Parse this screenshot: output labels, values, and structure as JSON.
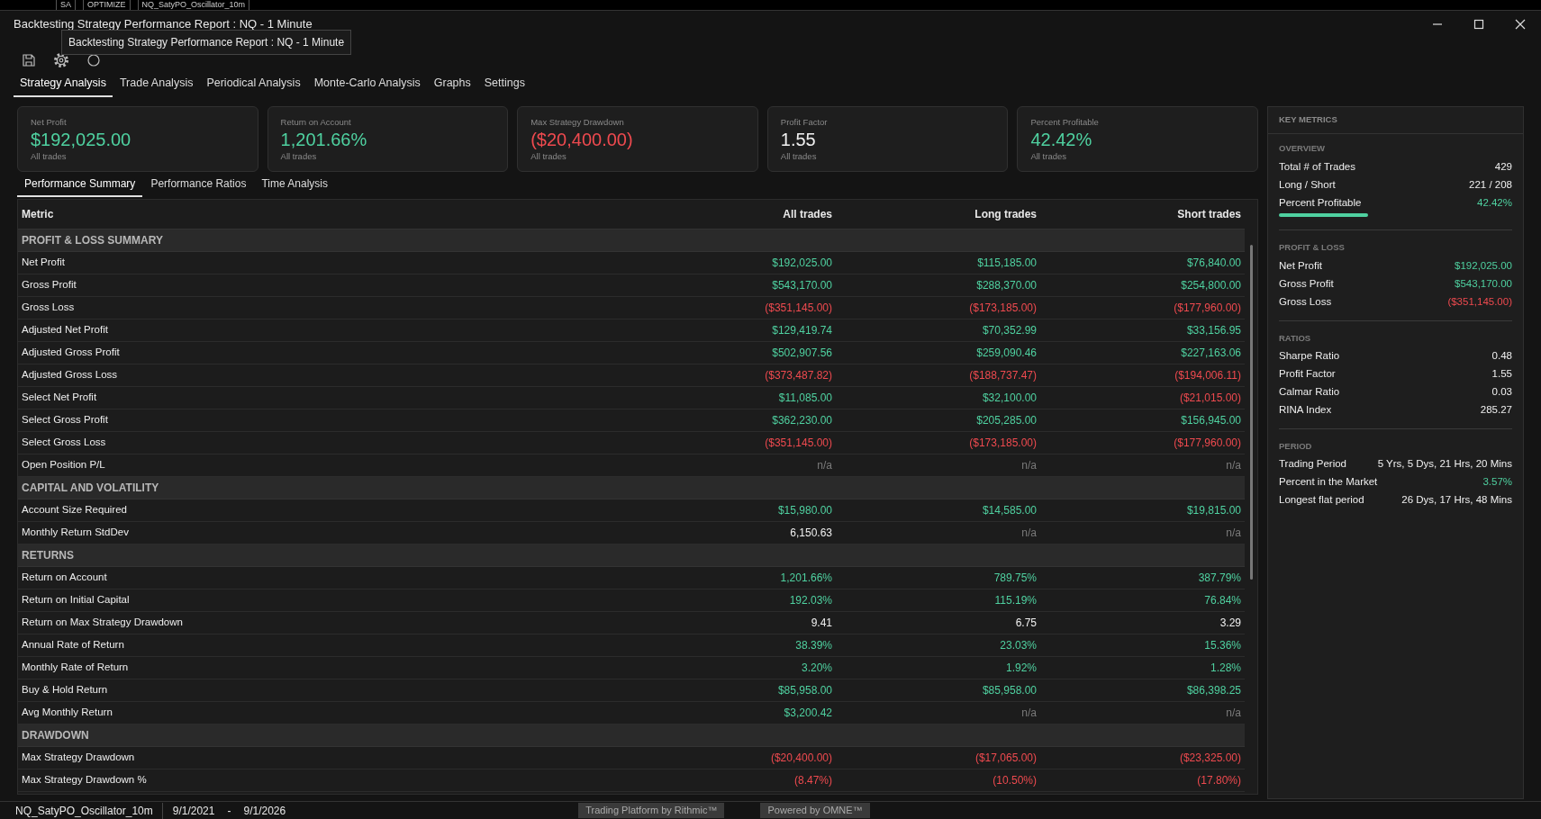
{
  "background_app": {
    "texts": [
      "SA",
      "OPTIMIZE",
      "NQ_SatyPO_Oscillator_10m"
    ]
  },
  "window": {
    "title": "Backtesting Strategy Performance Report : NQ - 1 Minute"
  },
  "tooltip": "Backtesting Strategy Performance Report : NQ - 1 Minute",
  "tabs": [
    {
      "label": "Strategy Analysis",
      "selected": true
    },
    {
      "label": "Trade Analysis",
      "selected": false
    },
    {
      "label": "Periodical Analysis",
      "selected": false
    },
    {
      "label": "Monte-Carlo Analysis",
      "selected": false
    },
    {
      "label": "Graphs",
      "selected": false
    },
    {
      "label": "Settings",
      "selected": false
    }
  ],
  "cards": [
    {
      "label": "Net Profit",
      "value": "$192,025.00",
      "color": "#4fd1a0",
      "note": "All trades"
    },
    {
      "label": "Return on Account",
      "value": "1,201.66%",
      "color": "#4fd1a0",
      "note": "All trades"
    },
    {
      "label": "Max Strategy Drawdown",
      "value": "($20,400.00)",
      "color": "#ef4a4f",
      "note": "All trades"
    },
    {
      "label": "Profit Factor",
      "value": "1.55",
      "color": "#f0f0f0",
      "note": "All trades"
    },
    {
      "label": "Percent Profitable",
      "value": "42.42%",
      "color": "#4fd1a0",
      "note": "All trades"
    }
  ],
  "subtabs": [
    {
      "label": "Performance Summary",
      "selected": true
    },
    {
      "label": "Performance Ratios",
      "selected": false
    },
    {
      "label": "Time Analysis",
      "selected": false
    }
  ],
  "table": {
    "columns": [
      "Metric",
      "All trades",
      "Long trades",
      "Short trades"
    ],
    "rows": [
      {
        "kind": "section",
        "label": "PROFIT & LOSS SUMMARY"
      },
      {
        "kind": "metric",
        "label": "Net Profit",
        "cells": [
          {
            "text": "$192,025.00",
            "color": "#4fd1a0"
          },
          {
            "text": "$115,185.00",
            "color": "#4fd1a0"
          },
          {
            "text": "$76,840.00",
            "color": "#4fd1a0"
          }
        ]
      },
      {
        "kind": "metric",
        "label": "Gross Profit",
        "cells": [
          {
            "text": "$543,170.00",
            "color": "#4fd1a0"
          },
          {
            "text": "$288,370.00",
            "color": "#4fd1a0"
          },
          {
            "text": "$254,800.00",
            "color": "#4fd1a0"
          }
        ]
      },
      {
        "kind": "metric",
        "label": "Gross Loss",
        "cells": [
          {
            "text": "($351,145.00)",
            "color": "#ef4a4f"
          },
          {
            "text": "($173,185.00)",
            "color": "#ef4a4f"
          },
          {
            "text": "($177,960.00)",
            "color": "#ef4a4f"
          }
        ]
      },
      {
        "kind": "metric",
        "label": "Adjusted Net Profit",
        "cells": [
          {
            "text": "$129,419.74",
            "color": "#4fd1a0"
          },
          {
            "text": "$70,352.99",
            "color": "#4fd1a0"
          },
          {
            "text": "$33,156.95",
            "color": "#4fd1a0"
          }
        ]
      },
      {
        "kind": "metric",
        "label": "Adjusted Gross Profit",
        "cells": [
          {
            "text": "$502,907.56",
            "color": "#4fd1a0"
          },
          {
            "text": "$259,090.46",
            "color": "#4fd1a0"
          },
          {
            "text": "$227,163.06",
            "color": "#4fd1a0"
          }
        ]
      },
      {
        "kind": "metric",
        "label": "Adjusted Gross Loss",
        "cells": [
          {
            "text": "($373,487.82)",
            "color": "#ef4a4f"
          },
          {
            "text": "($188,737.47)",
            "color": "#ef4a4f"
          },
          {
            "text": "($194,006.11)",
            "color": "#ef4a4f"
          }
        ]
      },
      {
        "kind": "metric",
        "label": "Select Net Profit",
        "cells": [
          {
            "text": "$11,085.00",
            "color": "#4fd1a0"
          },
          {
            "text": "$32,100.00",
            "color": "#4fd1a0"
          },
          {
            "text": "($21,015.00)",
            "color": "#ef4a4f"
          }
        ]
      },
      {
        "kind": "metric",
        "label": "Select Gross Profit",
        "cells": [
          {
            "text": "$362,230.00",
            "color": "#4fd1a0"
          },
          {
            "text": "$205,285.00",
            "color": "#4fd1a0"
          },
          {
            "text": "$156,945.00",
            "color": "#4fd1a0"
          }
        ]
      },
      {
        "kind": "metric",
        "label": "Select Gross Loss",
        "cells": [
          {
            "text": "($351,145.00)",
            "color": "#ef4a4f"
          },
          {
            "text": "($173,185.00)",
            "color": "#ef4a4f"
          },
          {
            "text": "($177,960.00)",
            "color": "#ef4a4f"
          }
        ]
      },
      {
        "kind": "metric",
        "label": "Open Position P/L",
        "cells": [
          {
            "text": "n/a",
            "color": "#7a7a7a"
          },
          {
            "text": "n/a",
            "color": "#7a7a7a"
          },
          {
            "text": "n/a",
            "color": "#7a7a7a"
          }
        ]
      },
      {
        "kind": "section",
        "label": "CAPITAL AND VOLATILITY"
      },
      {
        "kind": "metric",
        "label": "Account Size Required",
        "cells": [
          {
            "text": "$15,980.00",
            "color": "#4fd1a0"
          },
          {
            "text": "$14,585.00",
            "color": "#4fd1a0"
          },
          {
            "text": "$19,815.00",
            "color": "#4fd1a0"
          }
        ]
      },
      {
        "kind": "metric",
        "label": "Monthly Return StdDev",
        "cells": [
          {
            "text": "6,150.63",
            "color": "#f0f0f0"
          },
          {
            "text": "n/a",
            "color": "#7a7a7a"
          },
          {
            "text": "n/a",
            "color": "#7a7a7a"
          }
        ]
      },
      {
        "kind": "section",
        "label": "RETURNS"
      },
      {
        "kind": "metric",
        "label": "Return on Account",
        "cells": [
          {
            "text": "1,201.66%",
            "color": "#4fd1a0"
          },
          {
            "text": "789.75%",
            "color": "#4fd1a0"
          },
          {
            "text": "387.79%",
            "color": "#4fd1a0"
          }
        ]
      },
      {
        "kind": "metric",
        "label": "Return on Initial Capital",
        "cells": [
          {
            "text": "192.03%",
            "color": "#4fd1a0"
          },
          {
            "text": "115.19%",
            "color": "#4fd1a0"
          },
          {
            "text": "76.84%",
            "color": "#4fd1a0"
          }
        ]
      },
      {
        "kind": "metric",
        "label": "Return on Max Strategy Drawdown",
        "cells": [
          {
            "text": "9.41",
            "color": "#f0f0f0"
          },
          {
            "text": "6.75",
            "color": "#f0f0f0"
          },
          {
            "text": "3.29",
            "color": "#f0f0f0"
          }
        ]
      },
      {
        "kind": "metric",
        "label": "Annual Rate of Return",
        "cells": [
          {
            "text": "38.39%",
            "color": "#4fd1a0"
          },
          {
            "text": "23.03%",
            "color": "#4fd1a0"
          },
          {
            "text": "15.36%",
            "color": "#4fd1a0"
          }
        ]
      },
      {
        "kind": "metric",
        "label": "Monthly Rate of Return",
        "cells": [
          {
            "text": "3.20%",
            "color": "#4fd1a0"
          },
          {
            "text": "1.92%",
            "color": "#4fd1a0"
          },
          {
            "text": "1.28%",
            "color": "#4fd1a0"
          }
        ]
      },
      {
        "kind": "metric",
        "label": "Buy & Hold Return",
        "cells": [
          {
            "text": "$85,958.00",
            "color": "#4fd1a0"
          },
          {
            "text": "$85,958.00",
            "color": "#4fd1a0"
          },
          {
            "text": "$86,398.25",
            "color": "#4fd1a0"
          }
        ]
      },
      {
        "kind": "metric",
        "label": "Avg Monthly Return",
        "cells": [
          {
            "text": "$3,200.42",
            "color": "#4fd1a0"
          },
          {
            "text": "n/a",
            "color": "#7a7a7a"
          },
          {
            "text": "n/a",
            "color": "#7a7a7a"
          }
        ]
      },
      {
        "kind": "section",
        "label": "DRAWDOWN"
      },
      {
        "kind": "metric",
        "label": "Max Strategy Drawdown",
        "cells": [
          {
            "text": "($20,400.00)",
            "color": "#ef4a4f"
          },
          {
            "text": "($17,065.00)",
            "color": "#ef4a4f"
          },
          {
            "text": "($23,325.00)",
            "color": "#ef4a4f"
          }
        ]
      },
      {
        "kind": "metric",
        "label": "Max Strategy Drawdown %",
        "cells": [
          {
            "text": "(8.47%)",
            "color": "#ef4a4f"
          },
          {
            "text": "(10.50%)",
            "color": "#ef4a4f"
          },
          {
            "text": "(17.80%)",
            "color": "#ef4a4f"
          }
        ]
      }
    ]
  },
  "key_metrics": {
    "title": "KEY METRICS",
    "groups": [
      {
        "title": "OVERVIEW",
        "items": [
          {
            "label": "Total # of Trades",
            "value": "429",
            "color": "#f0f0f0"
          },
          {
            "label": "Long / Short",
            "value": "221 / 208",
            "color": "#f0f0f0"
          },
          {
            "label": "Percent Profitable",
            "value": "42.42%",
            "color": "#4fd1a0",
            "level": 0.4242
          }
        ]
      },
      {
        "title": "PROFIT & LOSS",
        "items": [
          {
            "label": "Net Profit",
            "value": "$192,025.00",
            "color": "#4fd1a0"
          },
          {
            "label": "Gross Profit",
            "value": "$543,170.00",
            "color": "#4fd1a0"
          },
          {
            "label": "Gross Loss",
            "value": "($351,145.00)",
            "color": "#ef4a4f"
          }
        ]
      },
      {
        "title": "RATIOS",
        "items": [
          {
            "label": "Sharpe Ratio",
            "value": "0.48",
            "color": "#f0f0f0"
          },
          {
            "label": "Profit Factor",
            "value": "1.55",
            "color": "#f0f0f0"
          },
          {
            "label": "Calmar Ratio",
            "value": "0.03",
            "color": "#f0f0f0"
          },
          {
            "label": "RINA Index",
            "value": "285.27",
            "color": "#f0f0f0"
          }
        ]
      },
      {
        "title": "PERIOD",
        "items": [
          {
            "label": "Trading Period",
            "value": "5 Yrs, 5 Dys, 21 Hrs, 20 Mins",
            "color": "#f0f0f0"
          },
          {
            "label": "Percent in the Market",
            "value": "3.57%",
            "color": "#4fd1a0"
          },
          {
            "label": "Longest flat period",
            "value": "26 Dys, 17 Hrs, 48 Mins",
            "color": "#f0f0f0"
          }
        ]
      }
    ]
  },
  "status_bar": {
    "strategy": "NQ_SatyPO_Oscillator_10m",
    "start": "9/1/2021",
    "separator": "-",
    "end": "9/1/2026",
    "badges": [
      "Trading Platform by Rithmic™",
      "Powered by OMNE™"
    ]
  }
}
